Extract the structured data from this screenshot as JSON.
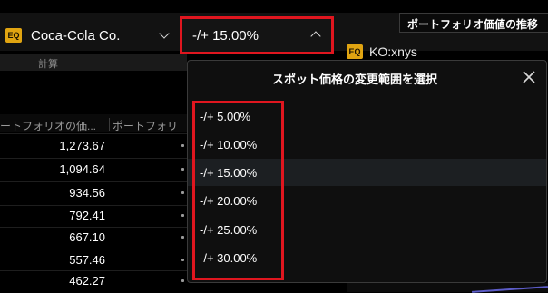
{
  "header": {
    "security": {
      "badge": "EQ",
      "name": "Coca-Cola Co."
    },
    "range_select": {
      "value": "-/+ 15.00%"
    }
  },
  "right_panel": {
    "title": "ポートフォリオ価値の推移",
    "ticker_badge": "EQ",
    "ticker": "KO:xnys"
  },
  "table": {
    "section_label": "計算",
    "columns": [
      "ートフォリオの価...",
      "ポートフォリ"
    ],
    "rows": [
      "1,273.67",
      "1,094.64",
      "934.56",
      "792.41",
      "667.10",
      "557.46",
      "462.27"
    ]
  },
  "dropdown": {
    "title": "スポット価格の変更範囲を選択",
    "options": [
      "-/+ 5.00%",
      "-/+ 10.00%",
      "-/+ 15.00%",
      "-/+ 20.00%",
      "-/+ 25.00%",
      "-/+ 30.00%"
    ],
    "selected_index": 2
  },
  "colors": {
    "highlight_outline": "#e0161f",
    "badge": "#e0a411",
    "selected_row": "#1c1f22"
  }
}
